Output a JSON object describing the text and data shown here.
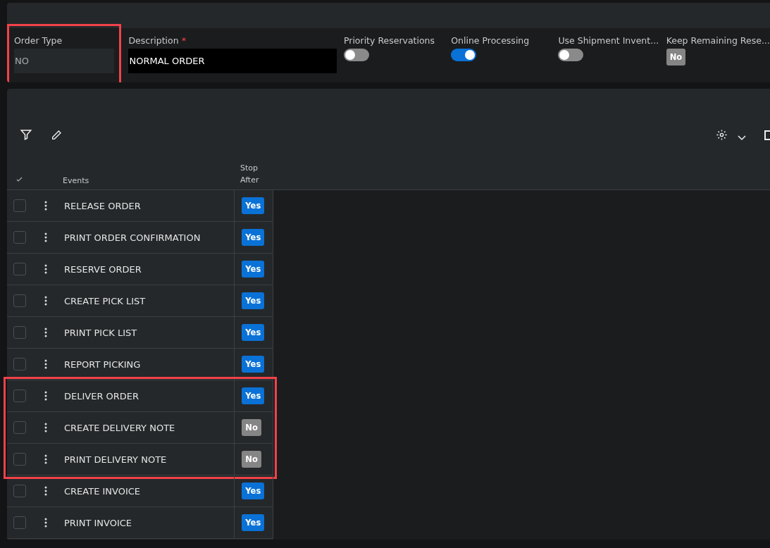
{
  "header": {
    "fields": [
      {
        "kind": "text",
        "label": "Order Type",
        "value": "NO",
        "highlighted": true
      },
      {
        "kind": "text",
        "label": "Description",
        "required_mark": "*",
        "value": "NORMAL ORDER",
        "highlighted": false
      },
      {
        "kind": "toggle",
        "label": "Priority Reservations",
        "on": false,
        "highlighted": false
      },
      {
        "kind": "toggle",
        "label": "Online Processing",
        "on": true,
        "highlighted": false
      },
      {
        "kind": "toggle",
        "label": "Use Shipment Invent...",
        "on": false,
        "highlighted": false
      },
      {
        "kind": "badge",
        "label": "Keep Remaining Rese...",
        "value": "No",
        "on": false,
        "highlighted": false
      }
    ]
  },
  "table": {
    "columns": [
      "Events",
      "Stop After"
    ],
    "rows": [
      {
        "event": "RELEASE ORDER",
        "stop_after": "Yes",
        "on": true,
        "checked": false,
        "highlighted": false
      },
      {
        "event": "PRINT ORDER CONFIRMATION",
        "stop_after": "Yes",
        "on": true,
        "checked": false,
        "highlighted": false
      },
      {
        "event": "RESERVE ORDER",
        "stop_after": "Yes",
        "on": true,
        "checked": false,
        "highlighted": false
      },
      {
        "event": "CREATE PICK LIST",
        "stop_after": "Yes",
        "on": true,
        "checked": false,
        "highlighted": false
      },
      {
        "event": "PRINT PICK LIST",
        "stop_after": "Yes",
        "on": true,
        "checked": false,
        "highlighted": false
      },
      {
        "event": "REPORT PICKING",
        "stop_after": "Yes",
        "on": true,
        "checked": false,
        "highlighted": false
      },
      {
        "event": "DELIVER ORDER",
        "stop_after": "Yes",
        "on": true,
        "checked": false,
        "highlighted": true
      },
      {
        "event": "CREATE DELIVERY NOTE",
        "stop_after": "No",
        "on": false,
        "checked": false,
        "highlighted": true
      },
      {
        "event": "PRINT DELIVERY NOTE",
        "stop_after": "No",
        "on": false,
        "checked": false,
        "highlighted": true
      },
      {
        "event": "CREATE INVOICE",
        "stop_after": "Yes",
        "on": true,
        "checked": false,
        "highlighted": false
      },
      {
        "event": "PRINT INVOICE",
        "stop_after": "Yes",
        "on": true,
        "checked": false,
        "highlighted": false
      }
    ]
  }
}
